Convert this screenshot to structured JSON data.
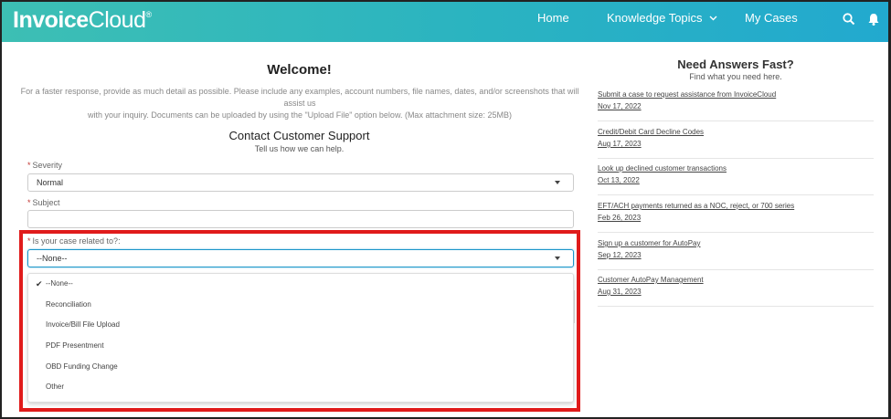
{
  "header": {
    "logo_bold": "Invoice",
    "logo_light": "Cloud",
    "logo_reg": "®",
    "nav": {
      "home": "Home",
      "topics": "Knowledge Topics",
      "cases": "My Cases"
    },
    "search_icon": "search-icon",
    "bell_icon": "bell-icon"
  },
  "main": {
    "welcome": "Welcome!",
    "intro_line1": "For a faster response, provide as much detail as possible. Please include any examples, account numbers, file names, dates, and/or screenshots that will assist us",
    "intro_line2": "with your inquiry. Documents can be uploaded by using the \"Upload File\" option below. (Max attachment size: 25MB)",
    "contact_title": "Contact Customer Support",
    "contact_sub": "Tell us how we can help.",
    "required_mark": "*",
    "severity_label": "Severity",
    "severity_value": "Normal",
    "subject_label": "Subject",
    "related_label": "Is your case related to?:",
    "related_value": "--None--",
    "options": [
      "--None--",
      "Reconciliation",
      "Invoice/Bill File Upload",
      "PDF Presentment",
      "OBD Funding Change",
      "Other"
    ],
    "check_glyph": "✔",
    "highlight_color": "#e01b1b"
  },
  "sidebar": {
    "title": "Need Answers Fast?",
    "subtitle": "Find what you need here.",
    "articles": [
      {
        "title": "Submit a case to request assistance from InvoiceCloud",
        "date": "Nov 17, 2022"
      },
      {
        "title": "Credit/Debit Card Decline Codes",
        "date": "Aug 17, 2023"
      },
      {
        "title": "Look up declined customer transactions",
        "date": "Oct 13, 2022"
      },
      {
        "title": "EFT/ACH payments returned as a NOC, reject, or 700 series",
        "date": "Feb 26, 2023"
      },
      {
        "title": "Sign up a customer for AutoPay",
        "date": "Sep 12, 2023"
      },
      {
        "title": "Customer AutoPay Management",
        "date": "Aug 31, 2023"
      }
    ]
  },
  "colors": {
    "header_start": "#3dbfb4",
    "header_end": "#22a9cf",
    "required": "#c23934"
  }
}
